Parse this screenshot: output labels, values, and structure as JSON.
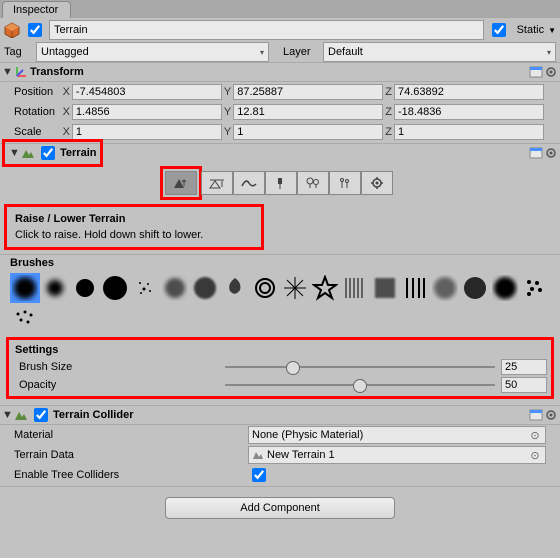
{
  "tabs": {
    "inspector": "Inspector"
  },
  "header": {
    "name": "Terrain",
    "static_label": "Static",
    "static_checked": true,
    "tag_label": "Tag",
    "tag_value": "Untagged",
    "layer_label": "Layer",
    "layer_value": "Default"
  },
  "transform": {
    "title": "Transform",
    "position_label": "Position",
    "rotation_label": "Rotation",
    "scale_label": "Scale",
    "position": {
      "x": "-7.454803",
      "y": "87.25887",
      "z": "74.63892"
    },
    "rotation": {
      "x": "1.4856",
      "y": "12.81",
      "z": "-18.4836"
    },
    "scale": {
      "x": "1",
      "y": "1",
      "z": "1"
    },
    "axis": {
      "x": "X",
      "y": "Y",
      "z": "Z"
    }
  },
  "terrain": {
    "title": "Terrain",
    "hint_title": "Raise / Lower Terrain",
    "hint_body": "Click to raise. Hold down shift to lower.",
    "brushes_label": "Brushes",
    "settings_label": "Settings",
    "brush_size_label": "Brush Size",
    "brush_size_value": "25",
    "opacity_label": "Opacity",
    "opacity_value": "50"
  },
  "collider": {
    "title": "Terrain Collider",
    "material_label": "Material",
    "material_value": "None (Physic Material)",
    "terrain_data_label": "Terrain Data",
    "terrain_data_value": "New Terrain 1",
    "enable_tree_label": "Enable Tree Colliders",
    "enable_tree_checked": true
  },
  "add_component": "Add Component"
}
